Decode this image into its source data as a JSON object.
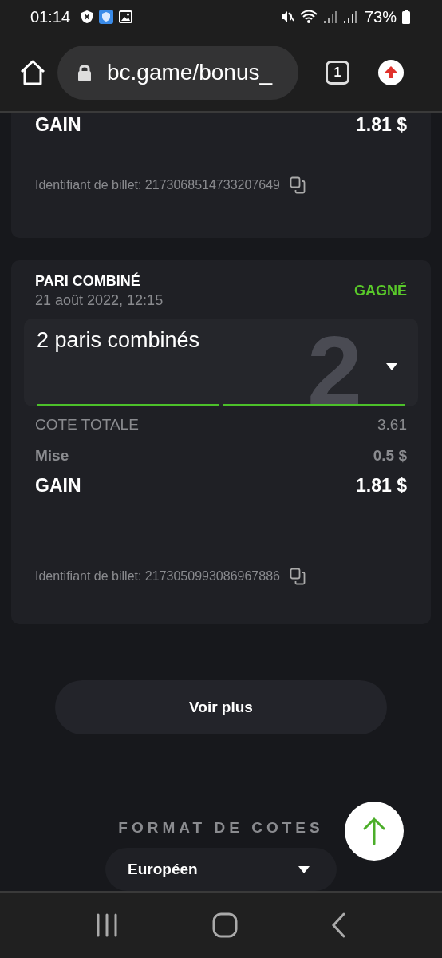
{
  "status_bar": {
    "time": "01:14",
    "battery": "73%"
  },
  "browser": {
    "url": "bc.game/bonus_",
    "tab_count": "1"
  },
  "bets": [
    {
      "kind": "tail",
      "gain_label": "GAIN",
      "gain": "1.81 $",
      "ticket_label": "Identifiant de billet: 2173068514733207649"
    },
    {
      "kind": "full",
      "type": "PARI COMBINÉ",
      "date": "21 août 2022, 12:15",
      "status": "GAGNÉ",
      "won": true,
      "combo_title": "2 paris combinés",
      "combo_count": "2",
      "expanded": false,
      "legs": [
        {
          "won": true
        },
        {
          "won": true
        }
      ],
      "odds_label": "COTE TOTALE",
      "odds": "3.61",
      "stake_label": "Mise",
      "stake": "0.5 $",
      "gain_label": "GAIN",
      "gain": "1.81 $",
      "ticket_label": "Identifiant de billet: 2173050993086967886"
    }
  ],
  "more_button": "Voir plus",
  "odds_format": {
    "title": "FORMAT DE COTES",
    "value": "Européen"
  }
}
